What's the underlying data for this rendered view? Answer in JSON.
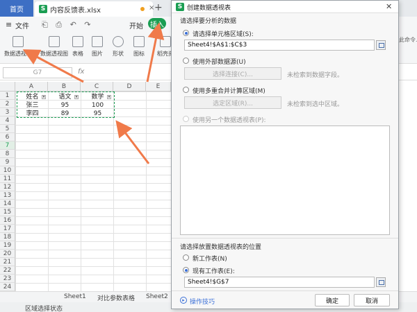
{
  "app": {
    "home_tab": "首页",
    "doc_tab": "内容反馈表.xlsx",
    "tab_logo": "S",
    "new_tab": "+"
  },
  "menu": {
    "file": "文件",
    "start": "开始",
    "insert": "插入",
    "menu_glyph": "≡",
    "tools_glyphs": "⎗ ⎙ ↶ ↷"
  },
  "ribbon": {
    "items": [
      "数据透视表",
      "数据透视图",
      "表格",
      "图片",
      "形状",
      "图标",
      "稻壳资"
    ]
  },
  "formula": {
    "namebox": "G7",
    "fx": "fx"
  },
  "sheet": {
    "columns": [
      "A",
      "B",
      "C",
      "D",
      "E"
    ],
    "rows": [
      "1",
      "2",
      "3",
      "4",
      "5",
      "6",
      "7",
      "8",
      "9",
      "10",
      "11",
      "12",
      "13",
      "14",
      "15",
      "16",
      "17",
      "18",
      "19",
      "20",
      "21",
      "22",
      "23",
      "24"
    ],
    "headers": [
      "姓名",
      "语文",
      "数学"
    ],
    "data": [
      [
        "张三",
        "95",
        "100"
      ],
      [
        "李四",
        "89",
        "95"
      ]
    ]
  },
  "sheet_tabs": [
    "Sheet1",
    "对比参数表格",
    "Sheet2"
  ],
  "status": "区域选择状态",
  "right_hint": "找此命令...",
  "dialog": {
    "title": "创建数据透视表",
    "close": "✕",
    "section1": "请选择要分析的数据",
    "opt_range": "请选择单元格区域(S):",
    "range_value": "Sheet4!$A$1:$C$3",
    "opt_external": "使用外部数据源(U)",
    "btn_choose_conn": "选择连接(C)...",
    "hint_conn": "未检索到数据字段。",
    "opt_multi": "使用多重合并计算区域(M)",
    "btn_choose_region": "选定区域(R)...",
    "hint_region": "未检索到选中区域。",
    "opt_another": "使用另一个数据透视表(P):",
    "section2": "请选择放置数据透视表的位置",
    "opt_new_sheet": "新工作表(N)",
    "opt_existing": "现有工作表(E):",
    "existing_value": "Sheet4!$G$7",
    "tips": "操作技巧",
    "ok": "确定",
    "cancel": "取消"
  },
  "colors": {
    "accent": "#1b9e53",
    "home_tab": "#3d6fc4",
    "arrow": "#f07a4a",
    "link": "#3a6fd8"
  }
}
